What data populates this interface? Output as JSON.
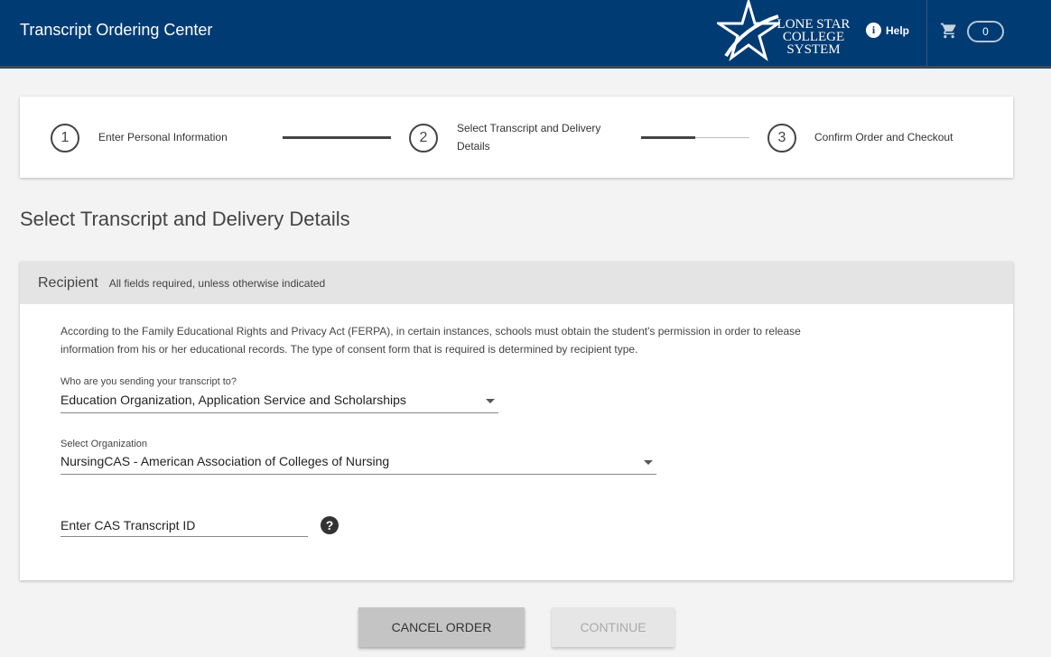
{
  "header": {
    "title": "Transcript Ordering Center",
    "logo_lines": [
      "LONE STAR",
      "COLLEGE",
      "SYSTEM"
    ],
    "help_label": "Help",
    "help_icon": "i",
    "cart_count": "0"
  },
  "stepper": {
    "steps": [
      {
        "number": "1",
        "label": "Enter Personal Information"
      },
      {
        "number": "2",
        "label_line1": "Select Transcript and Delivery",
        "label_line2": "Details"
      },
      {
        "number": "3",
        "label": "Confirm Order and Checkout"
      }
    ]
  },
  "page": {
    "title": "Select Transcript and Delivery Details"
  },
  "recipient": {
    "title": "Recipient",
    "subtitle": "All fields required, unless otherwise indicated",
    "ferpa_line1": "According to the Family Educational Rights and Privacy Act (FERPA), in certain instances, schools must obtain the student's permission in order to release",
    "ferpa_line2": "information from his or her educational records. The type of consent form that is required is determined by recipient type.",
    "recipient_type_label": "Who are you sending your transcript to?",
    "recipient_type_value": "Education Organization, Application Service and Scholarships",
    "organization_label": "Select Organization",
    "organization_value": "NursingCAS - American Association of Colleges of Nursing",
    "cas_id_placeholder": "Enter CAS Transcript ID",
    "help_icon": "?"
  },
  "actions": {
    "cancel_label": "CANCEL ORDER",
    "continue_label": "CONTINUE"
  },
  "colors": {
    "header_bg": "#003b73",
    "card_header_bg": "#e4e4e4"
  }
}
